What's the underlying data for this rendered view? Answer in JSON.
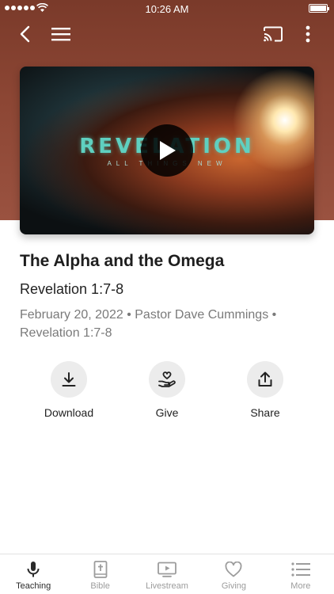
{
  "status_bar": {
    "time": "10:26 AM"
  },
  "video": {
    "art_title": "REVELATION",
    "art_subtitle": "ALL THINGS NEW"
  },
  "sermon": {
    "title": "The Alpha and the Omega",
    "reference": "Revelation 1:7-8",
    "meta": "February 20, 2022 • Pastor Dave Cummings • Revelation 1:7-8"
  },
  "actions": [
    {
      "label": "Download",
      "icon": "download-icon"
    },
    {
      "label": "Give",
      "icon": "giving-hand-icon"
    },
    {
      "label": "Share",
      "icon": "share-icon"
    }
  ],
  "tabs": [
    {
      "label": "Teaching",
      "icon": "microphone-icon",
      "active": true
    },
    {
      "label": "Bible",
      "icon": "bible-icon",
      "active": false
    },
    {
      "label": "Livestream",
      "icon": "livestream-icon",
      "active": false
    },
    {
      "label": "Giving",
      "icon": "heart-icon",
      "active": false
    },
    {
      "label": "More",
      "icon": "list-icon",
      "active": false
    }
  ],
  "colors": {
    "header_background": "#8c4634",
    "active_tab": "#2a2a2a",
    "inactive_tab": "#9c9c9c",
    "action_circle": "#ececec"
  }
}
